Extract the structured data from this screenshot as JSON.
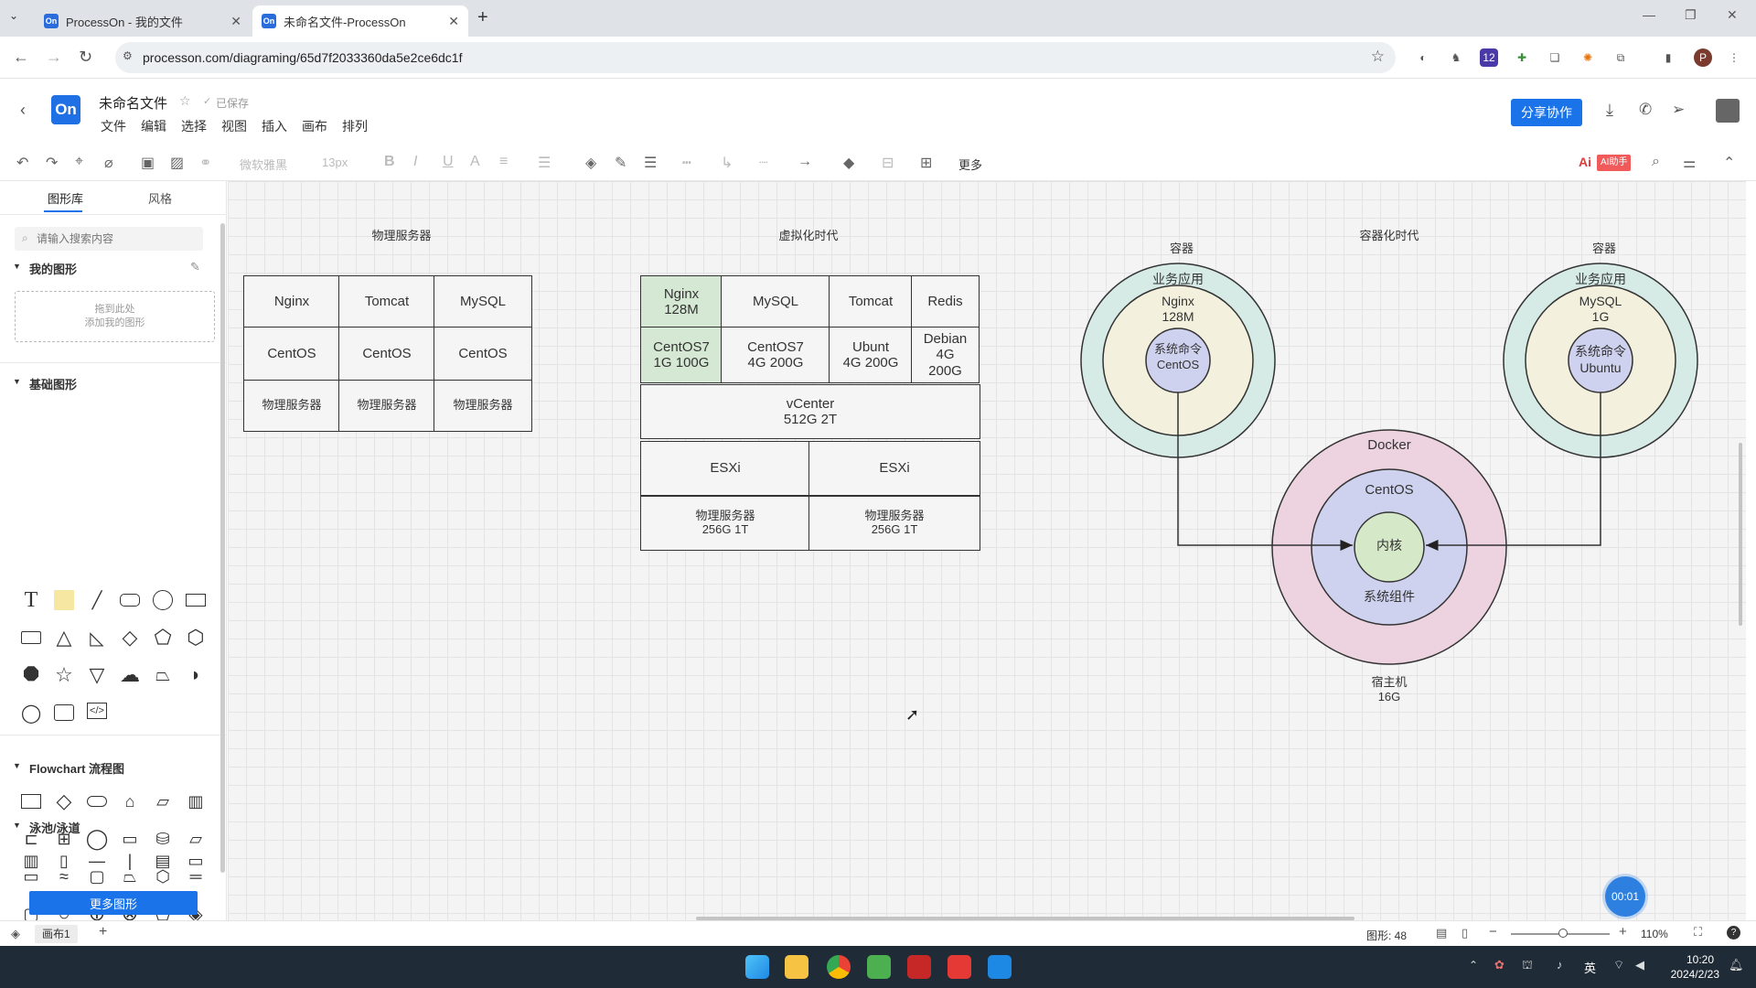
{
  "browser": {
    "tabs": [
      {
        "favicon": "On",
        "title": "ProcessOn - 我的文件"
      },
      {
        "favicon": "On",
        "title": "未命名文件-ProcessOn"
      }
    ],
    "url": "processon.com/diagraming/65d7f2033360da5e2ce6dc1f",
    "profile_initial": "P",
    "extension_badge": "12"
  },
  "app": {
    "logo": "On",
    "file_name": "未命名文件",
    "save_status": "已保存",
    "menu": [
      "文件",
      "编辑",
      "选择",
      "视图",
      "插入",
      "画布",
      "排列"
    ],
    "share_button": "分享协作",
    "toolbar": {
      "font_family": "微软雅黑",
      "font_size": "13px",
      "more": "更多",
      "ai_button": "AI助手"
    }
  },
  "sidebar": {
    "tabs": [
      "图形库",
      "风格"
    ],
    "search_placeholder": "请输入搜索内容",
    "my_shapes_title": "我的图形",
    "drop_hint": "拖到此处\n添加我的图形",
    "basic_title": "基础图形",
    "flowchart_title": "Flowchart 流程图",
    "swimlane_title": "泳池/泳道",
    "more_button": "更多图形"
  },
  "diagram": {
    "physical": {
      "title": "物理服务器",
      "apps": [
        "Nginx",
        "Tomcat",
        "MySQL"
      ],
      "os": [
        "CentOS",
        "CentOS",
        "CentOS"
      ],
      "hw": [
        "物理服务器",
        "物理服务器",
        "物理服务器"
      ]
    },
    "virtual": {
      "title": "虚拟化时代",
      "apps": [
        "Nginx\n128M",
        "MySQL",
        "Tomcat",
        "Redis"
      ],
      "os": [
        "CentOS7\n1G 100G",
        "CentOS7\n4G 200G",
        "Ubunt\n4G 200G",
        "Debian\n4G\n200G"
      ],
      "vcenter": "vCenter\n512G 2T",
      "esxi": [
        "ESXi",
        "ESXi"
      ],
      "hw": [
        "物理服务器\n256G 1T",
        "物理服务器\n256G 1T"
      ]
    },
    "container": {
      "title": "容器化时代",
      "left": {
        "label": "容器",
        "app_title": "业务应用",
        "app": "Nginx\n128M",
        "core": "系统命令\nCentOS"
      },
      "right": {
        "label": "容器",
        "app_title": "业务应用",
        "app": "MySQL\n1G",
        "core": "系统命令\nUbuntu"
      },
      "docker": {
        "title": "Docker",
        "os": "CentOS",
        "kernel": "内核",
        "components": "系统组件",
        "host": "宿主机\n16G"
      },
      "colors": {
        "outer": "#d6ebe6",
        "app": "#f3f0dd",
        "core": "#cfd2ee",
        "docker": "#ecd3df",
        "kernel": "#d5e8c8"
      }
    }
  },
  "timer": "00:01",
  "status": {
    "page_tab": "画布1",
    "shape_count": "图形: 48",
    "zoom": "110%"
  },
  "taskbar": {
    "time": "10:20",
    "date": "2024/2/23",
    "ime": "英"
  }
}
